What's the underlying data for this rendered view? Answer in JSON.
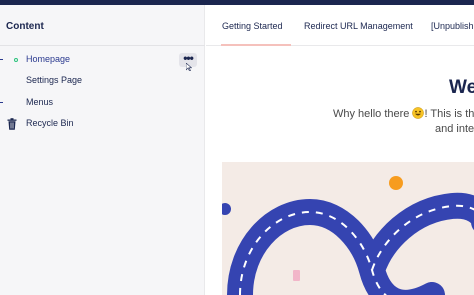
{
  "colors": {
    "topbar": "#1b264f",
    "accent_pink": "#f5c1bc",
    "panel_bg": "#f6f6f8",
    "text_primary": "#1b264f",
    "road_blue": "#3544b1",
    "sun_orange": "#f79c1f",
    "hero_bg": "#f4ebe6"
  },
  "tree": {
    "heading": "Content",
    "items": [
      {
        "label": "Homepage",
        "icon": "document-icon",
        "active": true
      },
      {
        "label": "Settings Page",
        "icon": "document-icon",
        "active": false
      },
      {
        "label": "Menus",
        "icon": "document-icon",
        "active": false
      },
      {
        "label": "Recycle Bin",
        "icon": "trash-icon",
        "active": false
      }
    ],
    "more_actions_label": "•••"
  },
  "tabs": [
    {
      "label": "Getting Started",
      "active": true
    },
    {
      "label": "Redirect URL Management",
      "active": false
    },
    {
      "label": "[Unpublish",
      "active": false
    }
  ],
  "dashboard": {
    "title": "We",
    "intro_before_emoji": "Why hello there ",
    "intro_after_emoji": "! This is th",
    "intro_line_2": "and inte"
  }
}
